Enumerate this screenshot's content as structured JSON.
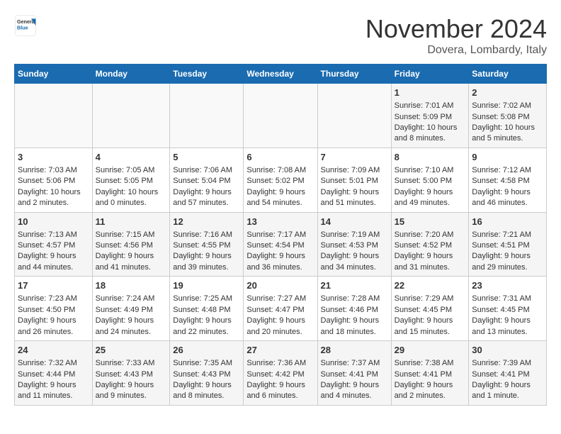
{
  "header": {
    "logo_general": "General",
    "logo_blue": "Blue",
    "month": "November 2024",
    "location": "Dovera, Lombardy, Italy"
  },
  "weekdays": [
    "Sunday",
    "Monday",
    "Tuesday",
    "Wednesday",
    "Thursday",
    "Friday",
    "Saturday"
  ],
  "weeks": [
    [
      {
        "day": "",
        "info": ""
      },
      {
        "day": "",
        "info": ""
      },
      {
        "day": "",
        "info": ""
      },
      {
        "day": "",
        "info": ""
      },
      {
        "day": "",
        "info": ""
      },
      {
        "day": "1",
        "info": "Sunrise: 7:01 AM\nSunset: 5:09 PM\nDaylight: 10 hours\nand 8 minutes."
      },
      {
        "day": "2",
        "info": "Sunrise: 7:02 AM\nSunset: 5:08 PM\nDaylight: 10 hours\nand 5 minutes."
      }
    ],
    [
      {
        "day": "3",
        "info": "Sunrise: 7:03 AM\nSunset: 5:06 PM\nDaylight: 10 hours\nand 2 minutes."
      },
      {
        "day": "4",
        "info": "Sunrise: 7:05 AM\nSunset: 5:05 PM\nDaylight: 10 hours\nand 0 minutes."
      },
      {
        "day": "5",
        "info": "Sunrise: 7:06 AM\nSunset: 5:04 PM\nDaylight: 9 hours\nand 57 minutes."
      },
      {
        "day": "6",
        "info": "Sunrise: 7:08 AM\nSunset: 5:02 PM\nDaylight: 9 hours\nand 54 minutes."
      },
      {
        "day": "7",
        "info": "Sunrise: 7:09 AM\nSunset: 5:01 PM\nDaylight: 9 hours\nand 51 minutes."
      },
      {
        "day": "8",
        "info": "Sunrise: 7:10 AM\nSunset: 5:00 PM\nDaylight: 9 hours\nand 49 minutes."
      },
      {
        "day": "9",
        "info": "Sunrise: 7:12 AM\nSunset: 4:58 PM\nDaylight: 9 hours\nand 46 minutes."
      }
    ],
    [
      {
        "day": "10",
        "info": "Sunrise: 7:13 AM\nSunset: 4:57 PM\nDaylight: 9 hours\nand 44 minutes."
      },
      {
        "day": "11",
        "info": "Sunrise: 7:15 AM\nSunset: 4:56 PM\nDaylight: 9 hours\nand 41 minutes."
      },
      {
        "day": "12",
        "info": "Sunrise: 7:16 AM\nSunset: 4:55 PM\nDaylight: 9 hours\nand 39 minutes."
      },
      {
        "day": "13",
        "info": "Sunrise: 7:17 AM\nSunset: 4:54 PM\nDaylight: 9 hours\nand 36 minutes."
      },
      {
        "day": "14",
        "info": "Sunrise: 7:19 AM\nSunset: 4:53 PM\nDaylight: 9 hours\nand 34 minutes."
      },
      {
        "day": "15",
        "info": "Sunrise: 7:20 AM\nSunset: 4:52 PM\nDaylight: 9 hours\nand 31 minutes."
      },
      {
        "day": "16",
        "info": "Sunrise: 7:21 AM\nSunset: 4:51 PM\nDaylight: 9 hours\nand 29 minutes."
      }
    ],
    [
      {
        "day": "17",
        "info": "Sunrise: 7:23 AM\nSunset: 4:50 PM\nDaylight: 9 hours\nand 26 minutes."
      },
      {
        "day": "18",
        "info": "Sunrise: 7:24 AM\nSunset: 4:49 PM\nDaylight: 9 hours\nand 24 minutes."
      },
      {
        "day": "19",
        "info": "Sunrise: 7:25 AM\nSunset: 4:48 PM\nDaylight: 9 hours\nand 22 minutes."
      },
      {
        "day": "20",
        "info": "Sunrise: 7:27 AM\nSunset: 4:47 PM\nDaylight: 9 hours\nand 20 minutes."
      },
      {
        "day": "21",
        "info": "Sunrise: 7:28 AM\nSunset: 4:46 PM\nDaylight: 9 hours\nand 18 minutes."
      },
      {
        "day": "22",
        "info": "Sunrise: 7:29 AM\nSunset: 4:45 PM\nDaylight: 9 hours\nand 15 minutes."
      },
      {
        "day": "23",
        "info": "Sunrise: 7:31 AM\nSunset: 4:45 PM\nDaylight: 9 hours\nand 13 minutes."
      }
    ],
    [
      {
        "day": "24",
        "info": "Sunrise: 7:32 AM\nSunset: 4:44 PM\nDaylight: 9 hours\nand 11 minutes."
      },
      {
        "day": "25",
        "info": "Sunrise: 7:33 AM\nSunset: 4:43 PM\nDaylight: 9 hours\nand 9 minutes."
      },
      {
        "day": "26",
        "info": "Sunrise: 7:35 AM\nSunset: 4:43 PM\nDaylight: 9 hours\nand 8 minutes."
      },
      {
        "day": "27",
        "info": "Sunrise: 7:36 AM\nSunset: 4:42 PM\nDaylight: 9 hours\nand 6 minutes."
      },
      {
        "day": "28",
        "info": "Sunrise: 7:37 AM\nSunset: 4:41 PM\nDaylight: 9 hours\nand 4 minutes."
      },
      {
        "day": "29",
        "info": "Sunrise: 7:38 AM\nSunset: 4:41 PM\nDaylight: 9 hours\nand 2 minutes."
      },
      {
        "day": "30",
        "info": "Sunrise: 7:39 AM\nSunset: 4:41 PM\nDaylight: 9 hours\nand 1 minute."
      }
    ]
  ]
}
